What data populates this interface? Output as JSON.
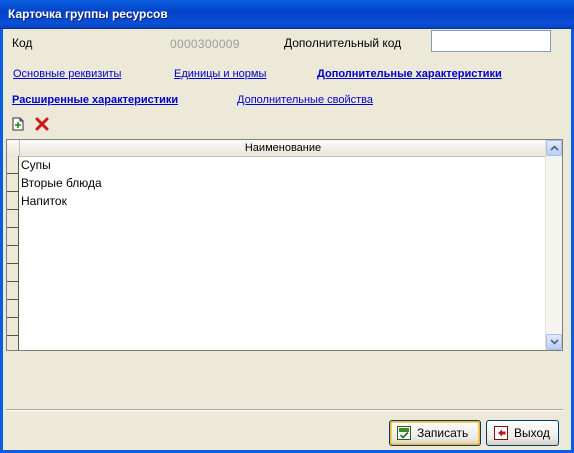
{
  "window": {
    "title": "Карточка группы ресурсов"
  },
  "header": {
    "code_label": "Код",
    "code_value": "0000300009",
    "extra_code_label": "Дополнительный код",
    "extra_code_value": ""
  },
  "tabs": [
    {
      "label": "Основные реквизиты",
      "active": false
    },
    {
      "label": "Единицы и нормы",
      "active": false
    },
    {
      "label": "Дополнительные характеристики",
      "active": true
    },
    {
      "label": "Расширенные характеристики",
      "active": true
    },
    {
      "label": "Дополнительные свойства",
      "active": false
    }
  ],
  "toolbar": {
    "add_icon": "add-row-icon",
    "delete_icon": "delete-row-icon"
  },
  "table": {
    "column_header": "Наименование",
    "rows": [
      "Супы",
      "Вторые блюда",
      "Напиток"
    ]
  },
  "buttons": {
    "save_label": "Записать",
    "exit_label": "Выход"
  },
  "colors": {
    "titlebar": "#0A5FE0",
    "window_bg": "#ECE9D8",
    "link": "#0000CC"
  }
}
